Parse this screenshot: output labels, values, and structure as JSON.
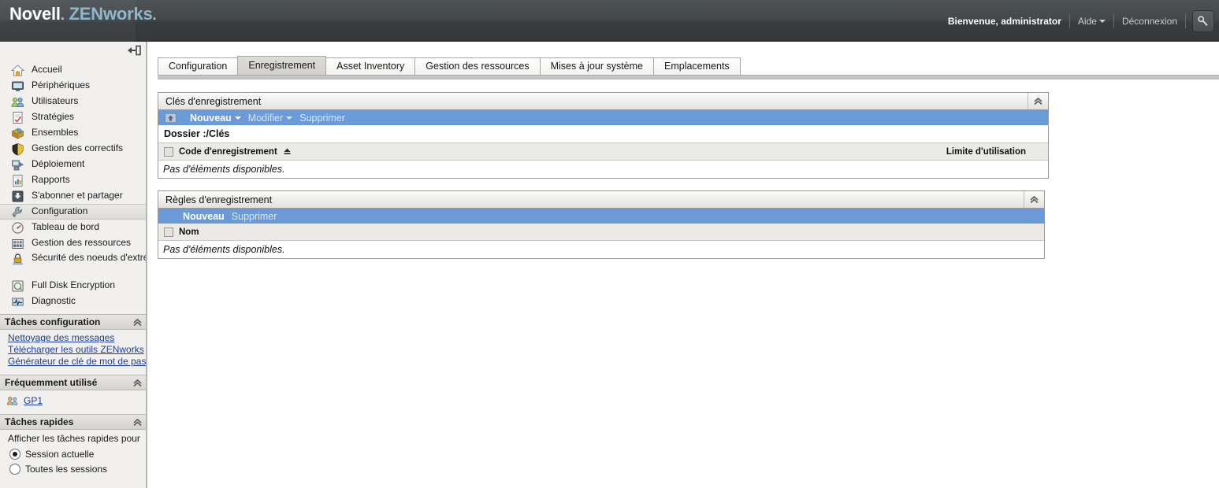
{
  "header": {
    "brand_novell": "Novell",
    "brand_dot": ".",
    "brand_zen": "ZENworks",
    "brand_zen_dot": ".",
    "welcome": "Bienvenue, administrator",
    "help": "Aide",
    "logout": "Déconnexion",
    "key_button_icon": "key-icon",
    "bg_start": "#4d5255",
    "bg_end": "#35383a",
    "accent": "#8bb8cc"
  },
  "sidebar": {
    "collapse_icon": "collapse-left-icon",
    "items": [
      {
        "label": "Accueil",
        "icon": "home-icon",
        "selected": false
      },
      {
        "label": "Périphériques",
        "icon": "monitor-icon",
        "selected": false
      },
      {
        "label": "Utilisateurs",
        "icon": "users-icon",
        "selected": false
      },
      {
        "label": "Stratégies",
        "icon": "policy-document-icon",
        "selected": false
      },
      {
        "label": "Ensembles",
        "icon": "bundle-box-icon",
        "selected": false
      },
      {
        "label": "Gestion des correctifs",
        "icon": "shield-icon",
        "selected": false
      },
      {
        "label": "Déploiement",
        "icon": "deployment-icon",
        "selected": false
      },
      {
        "label": "Rapports",
        "icon": "report-chart-icon",
        "selected": false
      },
      {
        "label": "S'abonner et partager",
        "icon": "subscribe-download-icon",
        "selected": false
      },
      {
        "label": "Configuration",
        "icon": "wrench-icon",
        "selected": true
      },
      {
        "label": "Tableau de bord",
        "icon": "gauge-icon",
        "selected": false
      },
      {
        "label": "Gestion des ressources",
        "icon": "asset-building-icon",
        "selected": false
      },
      {
        "label": "Sécurité des noeuds d'extrémité",
        "icon": "endpoint-lock-icon",
        "selected": false
      },
      {
        "label": "Full Disk Encryption",
        "icon": "disk-encryption-icon",
        "selected": false
      },
      {
        "label": "Diagnostic",
        "icon": "diagnostic-pulse-icon",
        "selected": false
      }
    ],
    "panels": {
      "config_tasks": {
        "title": "Tâches configuration",
        "collapse_icon": "chevron-up-icon",
        "links": [
          "Nettoyage des messages",
          "Télécharger les outils ZENworks",
          "Générateur de clé de mot de passe"
        ]
      },
      "frequently_used": {
        "title": "Fréquemment utilisé",
        "collapse_icon": "chevron-up-icon",
        "items": [
          {
            "label": "GP1",
            "icon": "users-group-icon"
          }
        ]
      },
      "quick_tasks": {
        "title": "Tâches rapides",
        "collapse_icon": "chevron-up-icon",
        "description": "Afficher les tâches rapides pour",
        "options": [
          {
            "label": "Session actuelle",
            "selected": true
          },
          {
            "label": "Toutes les sessions",
            "selected": false
          }
        ]
      }
    }
  },
  "main": {
    "tabs": [
      {
        "label": "Configuration",
        "active": false
      },
      {
        "label": "Enregistrement",
        "active": true
      },
      {
        "label": "Asset Inventory",
        "active": false
      },
      {
        "label": "Gestion des ressources",
        "active": false
      },
      {
        "label": "Mises à jour système",
        "active": false
      },
      {
        "label": "Emplacements",
        "active": false
      }
    ],
    "panels": [
      {
        "title": "Clés d'enregistrement",
        "collapse_icon": "chevron-up-icon",
        "toolbar": {
          "up_folder_icon": "folder-up-icon",
          "items": [
            {
              "label": "Nouveau",
              "has_caret": true,
              "enabled": true
            },
            {
              "label": "Modifier",
              "has_caret": true,
              "enabled": false
            },
            {
              "label": "Supprimer",
              "has_caret": false,
              "enabled": false
            }
          ]
        },
        "folder_path": "Dossier :/Clés",
        "columns": [
          {
            "label": "Code d'enregistrement",
            "sort_icon": "sort-ascending-icon",
            "align": "left"
          },
          {
            "label": "Limite d'utilisation",
            "sort_icon": "",
            "align": "right"
          }
        ],
        "empty_message": "Pas d'éléments disponibles."
      },
      {
        "title": "Règles d'enregistrement",
        "collapse_icon": "chevron-up-icon",
        "toolbar": {
          "up_folder_icon": "",
          "items": [
            {
              "label": "Nouveau",
              "has_caret": false,
              "enabled": true
            },
            {
              "label": "Supprimer",
              "has_caret": false,
              "enabled": false
            }
          ]
        },
        "folder_path": "",
        "columns": [
          {
            "label": "Nom",
            "sort_icon": "",
            "align": "left"
          }
        ],
        "empty_message": "Pas d'éléments disponibles."
      }
    ]
  },
  "colors": {
    "toolbar_blue": "#6a9bd8",
    "link_blue": "#1b3fa0",
    "panel_border": "#9b9995"
  }
}
